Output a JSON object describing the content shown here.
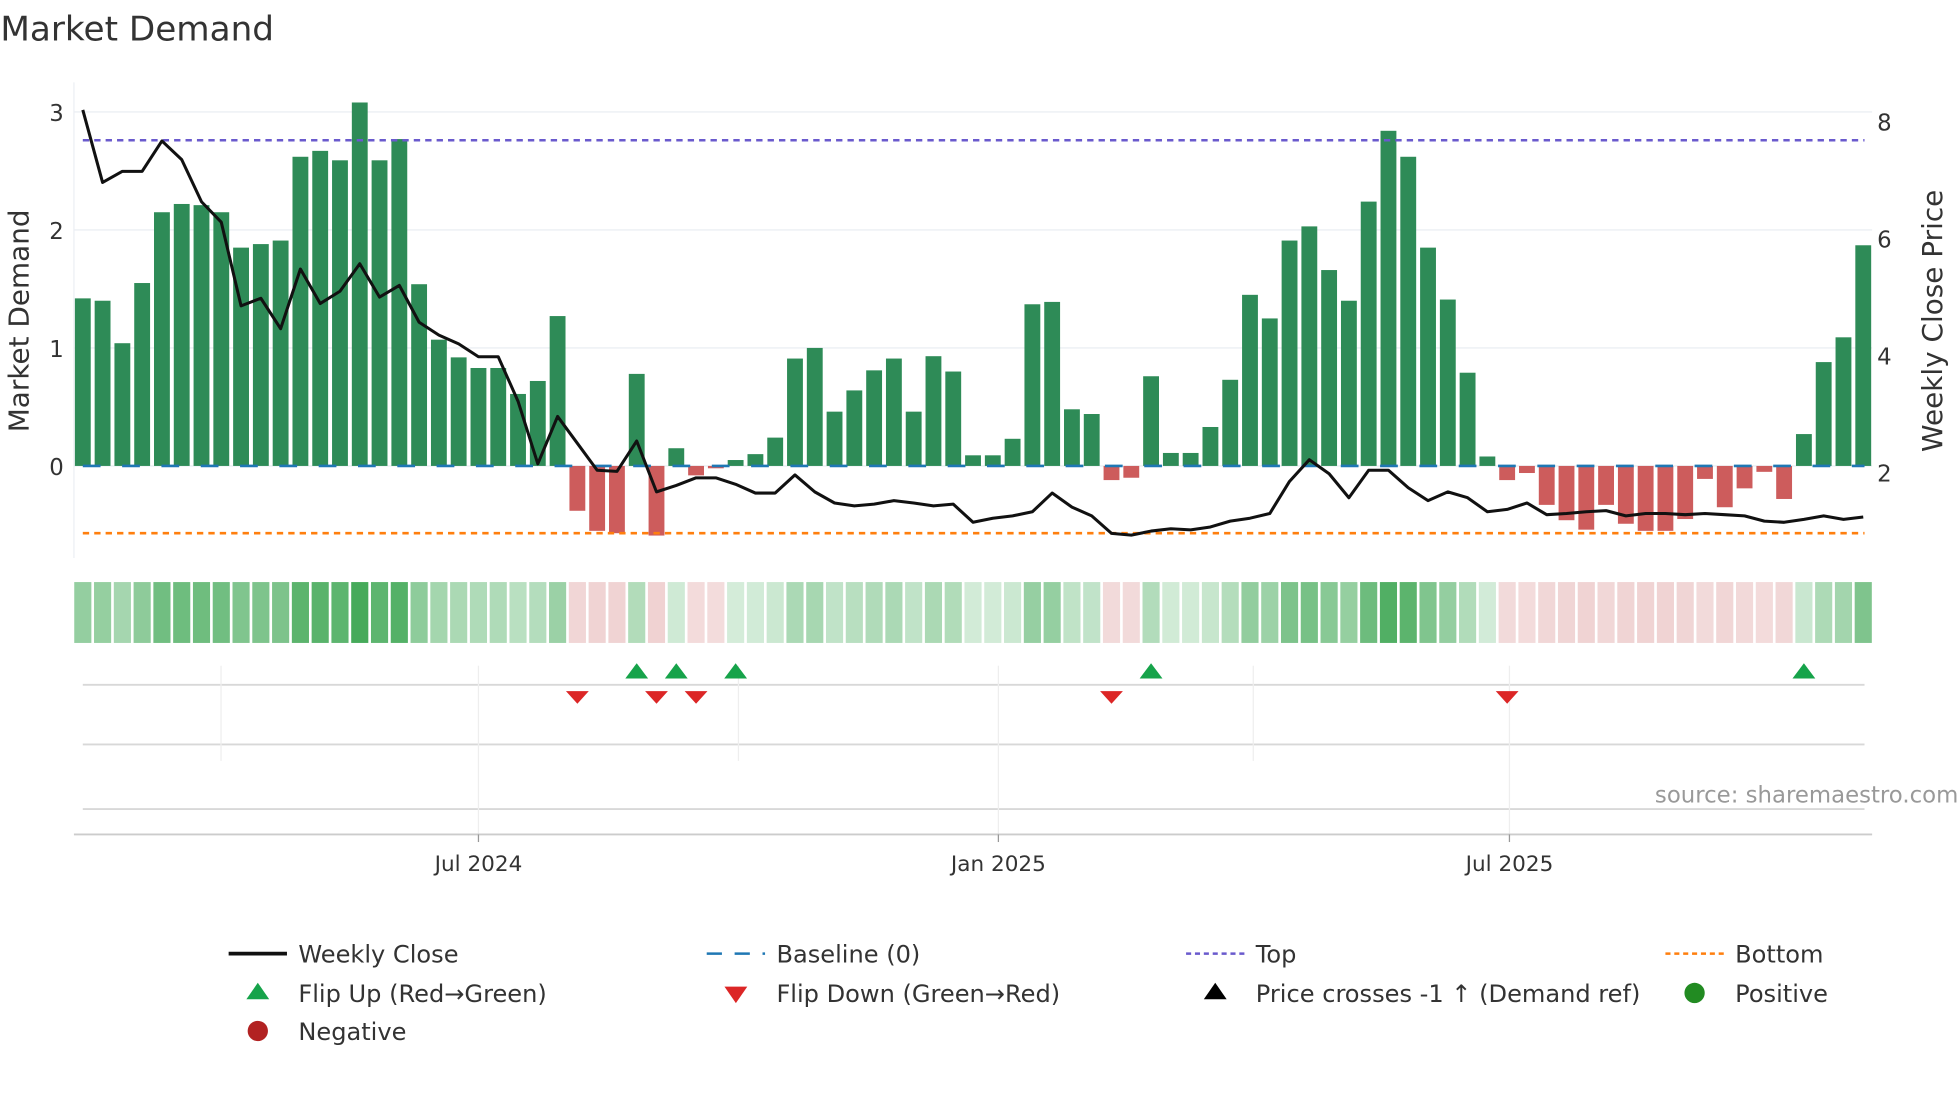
{
  "chart_data": {
    "type": "bar",
    "title": "Market Demand",
    "ylabel": "Market Demand",
    "y2label": "Weekly Close Price",
    "ylim": [
      -0.78,
      3.25
    ],
    "y2lim": [
      0.54,
      8.67
    ],
    "yticks": [
      "0",
      "1",
      "2",
      "3"
    ],
    "y2ticks": [
      "2",
      "4",
      "6",
      "8"
    ],
    "xticks": [
      "Jul 2024",
      "Jan 2025",
      "Jul 2025"
    ],
    "source": "source: sharemaestro.com",
    "top_level": 2.76,
    "bottom_level": -0.57,
    "baseline": 0,
    "demand": [
      1.42,
      1.4,
      1.04,
      1.55,
      2.15,
      2.22,
      2.21,
      2.15,
      1.85,
      1.88,
      1.91,
      2.62,
      2.67,
      2.59,
      3.08,
      2.59,
      2.77,
      1.54,
      1.07,
      0.92,
      0.83,
      0.83,
      0.61,
      0.72,
      1.27,
      -0.38,
      -0.55,
      -0.57,
      0.78,
      -0.59,
      0.15,
      -0.08,
      -0.02,
      0.05,
      0.1,
      0.24,
      0.91,
      1.0,
      0.46,
      0.64,
      0.81,
      0.91,
      0.46,
      0.93,
      0.8,
      0.09,
      0.09,
      0.23,
      1.37,
      1.39,
      0.48,
      0.44,
      -0.12,
      -0.1,
      0.76,
      0.11,
      0.11,
      0.33,
      0.73,
      1.45,
      1.25,
      1.91,
      2.03,
      1.66,
      1.4,
      2.24,
      2.84,
      2.62,
      1.85,
      1.41,
      0.79,
      0.08,
      -0.12,
      -0.06,
      -0.33,
      -0.46,
      -0.54,
      -0.33,
      -0.49,
      -0.55,
      -0.55,
      -0.45,
      -0.11,
      -0.35,
      -0.19,
      -0.05,
      -0.28,
      0.27,
      0.88,
      1.09,
      1.87
    ],
    "weekly_close": [
      8.2,
      6.96,
      7.15,
      7.15,
      7.67,
      7.35,
      6.63,
      6.28,
      4.85,
      4.98,
      4.46,
      5.48,
      4.89,
      5.1,
      5.57,
      5.0,
      5.2,
      4.57,
      4.35,
      4.2,
      3.98,
      3.98,
      3.22,
      2.15,
      2.96,
      2.5,
      2.04,
      2.02,
      2.54,
      1.67,
      1.78,
      1.91,
      1.91,
      1.8,
      1.65,
      1.65,
      1.96,
      1.67,
      1.48,
      1.43,
      1.46,
      1.52,
      1.48,
      1.43,
      1.46,
      1.15,
      1.22,
      1.26,
      1.33,
      1.65,
      1.41,
      1.26,
      0.96,
      0.93,
      1.0,
      1.04,
      1.02,
      1.07,
      1.17,
      1.22,
      1.3,
      1.85,
      2.22,
      1.98,
      1.57,
      2.04,
      2.04,
      1.74,
      1.52,
      1.67,
      1.57,
      1.33,
      1.37,
      1.48,
      1.28,
      1.3,
      1.33,
      1.35,
      1.26,
      1.3,
      1.3,
      1.28,
      1.3,
      1.28,
      1.26,
      1.17,
      1.15,
      1.2,
      1.26,
      1.2,
      1.24
    ],
    "flip_up_weeks": [
      28,
      30,
      33,
      54,
      87
    ],
    "flip_down_weeks": [
      25,
      29,
      31,
      52,
      72
    ],
    "legend": [
      {
        "label": "Weekly Close",
        "symbol": "line",
        "color": "#111111"
      },
      {
        "label": "Baseline (0)",
        "symbol": "dash",
        "color": "#1f77b4"
      },
      {
        "label": "Top",
        "symbol": "dot",
        "color": "#6a5acd"
      },
      {
        "label": "Bottom",
        "symbol": "dot",
        "color": "#ff7f0e"
      },
      {
        "label": "Flip Up (Red→Green)",
        "symbol": "triangle-up",
        "color": "#16a34a"
      },
      {
        "label": "Flip Down (Green→Red)",
        "symbol": "triangle-down",
        "color": "#dc2626"
      },
      {
        "label": "Price crosses -1 ↑ (Demand ref)",
        "symbol": "triangle-up",
        "color": "#000000"
      },
      {
        "label": "Positive",
        "symbol": "circle",
        "color": "#228b22"
      },
      {
        "label": "Negative",
        "symbol": "circle",
        "color": "#b22222"
      }
    ],
    "colors": {
      "positive_bar": "#2e8b57",
      "negative_bar": "#cd5c5c"
    }
  }
}
